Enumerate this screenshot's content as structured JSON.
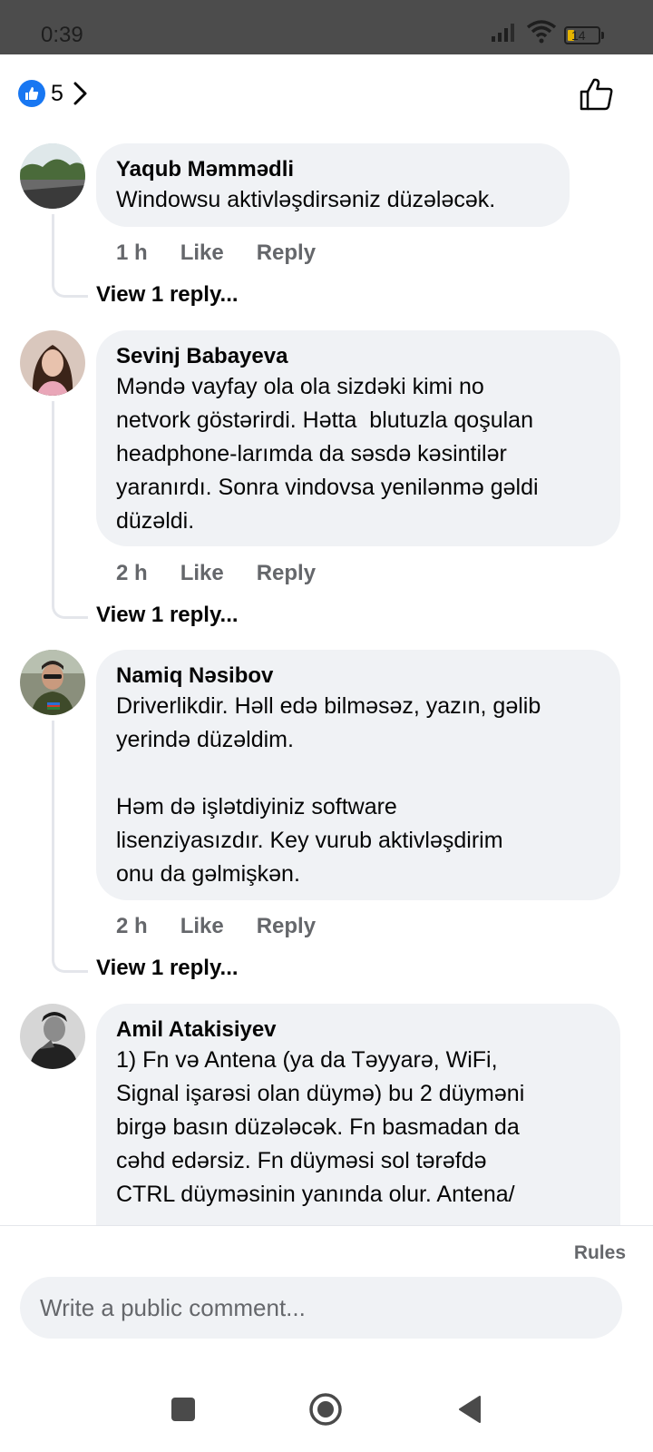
{
  "status_bar": {
    "time": "0:39",
    "battery": "14"
  },
  "reactions": {
    "count": "5",
    "like_icon": "thumbs-up-icon"
  },
  "comments": [
    {
      "author": "Yaqub Məmmədli",
      "text": "Windowsu aktivləşdirsəniz düzələcək.",
      "time": "1 h",
      "like_label": "Like",
      "reply_label": "Reply",
      "view_replies": "View 1 reply..."
    },
    {
      "author": "Sevinj Babayeva",
      "text": "Məndə vayfay ola ola sizdəki kimi no\nnetvork göstərirdi. Hətta  blutuzla qoşulan\nheadphone-larımda da səsdə kəsintilər\nyaranırdı. Sonra vindovsa yenilənmə gəldi\ndüzəldi.",
      "time": "2 h",
      "like_label": "Like",
      "reply_label": "Reply",
      "view_replies": "View 1 reply..."
    },
    {
      "author": "Namiq Nəsibov",
      "text": "Driverlikdir. Həll edə bilməsəz, yazın, gəlib\nyerində düzəldim.\n\nHəm də işlətdiyiniz software\nlisenziyasızdır. Key vurub aktivləşdirim\nonu da gəlmişkən.",
      "time": "2 h",
      "like_label": "Like",
      "reply_label": "Reply",
      "view_replies": "View 1 reply..."
    },
    {
      "author": "Amil Atakisiyev",
      "text": "1) Fn və Antena (ya da Təyyarə, WiFi,\nSignal işarəsi olan düymə) bu 2 düyməni\nbirgə basın düzələcək. Fn basmadan da\ncəhd edərsiz. Fn düyməsi sol tərəfdə\nCTRL düyməsinin yanında olur. Antena/"
    }
  ],
  "composer": {
    "rules_label": "Rules",
    "placeholder": "Write a public comment..."
  },
  "colors": {
    "accent": "#1877f2",
    "bubble": "#f0f2f5",
    "muted": "#65676b"
  }
}
